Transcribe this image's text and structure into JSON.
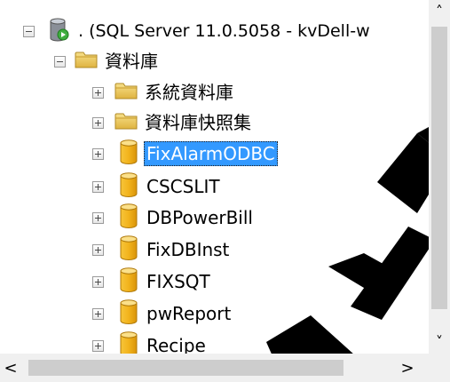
{
  "tree": {
    "root": {
      "label": ". (SQL Server 11.0.5058 - kvDell-w",
      "expanded": true,
      "icon": "server-icon"
    },
    "folder": {
      "label": "資料庫",
      "expanded": true,
      "icon": "folder-icon"
    },
    "items": [
      {
        "label": "系統資料庫",
        "icon": "folder-icon",
        "selected": false
      },
      {
        "label": "資料庫快照集",
        "icon": "folder-icon",
        "selected": false
      },
      {
        "label": "FixAlarmODBC",
        "icon": "database-icon",
        "selected": true
      },
      {
        "label": "CSCSLIT",
        "icon": "database-icon",
        "selected": false
      },
      {
        "label": "DBPowerBill",
        "icon": "database-icon",
        "selected": false
      },
      {
        "label": "FixDBInst",
        "icon": "database-icon",
        "selected": false
      },
      {
        "label": "FIXSQT",
        "icon": "database-icon",
        "selected": false
      },
      {
        "label": "pwReport",
        "icon": "database-icon",
        "selected": false
      },
      {
        "label": "Recipe",
        "icon": "database-icon",
        "selected": false
      }
    ]
  },
  "colors": {
    "selection": "#3399ff",
    "folder": "#e8c25a",
    "database": "#f2b31c",
    "scrollbar_track": "#f0f0f0",
    "scrollbar_thumb": "#cdcdcd"
  },
  "scrollbars": {
    "up_arrow": "˄",
    "down_arrow": "˅",
    "left_arrow": "<",
    "right_arrow": ">"
  }
}
